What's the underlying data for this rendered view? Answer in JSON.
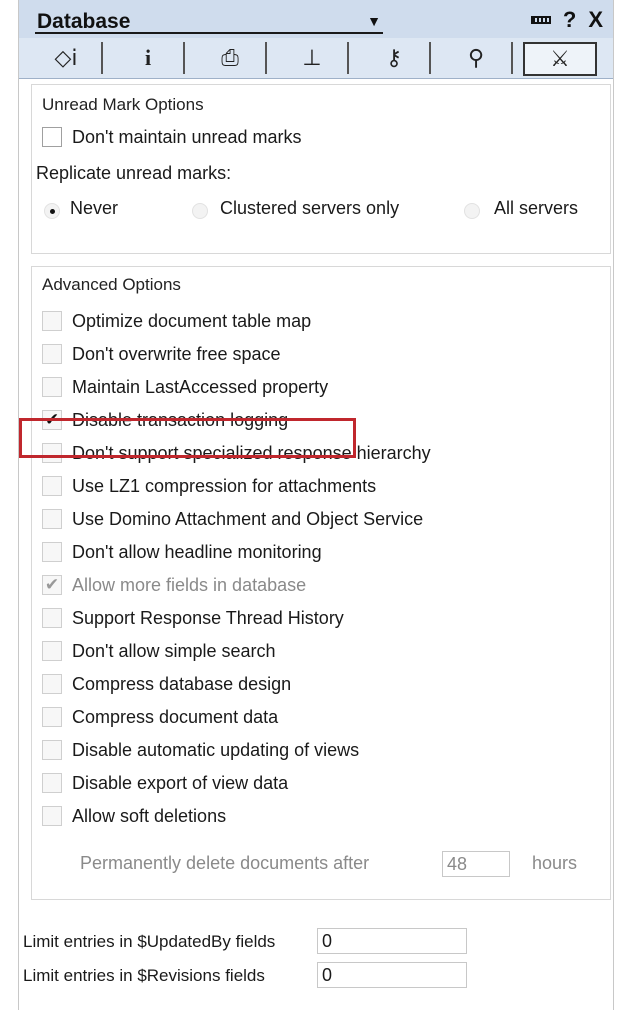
{
  "header": {
    "title": "Database",
    "question_glyph": "?",
    "close_glyph": "X"
  },
  "tabs": [
    {
      "icon": "info-pages-icon",
      "glyph": "◇ⅰ"
    },
    {
      "icon": "info-icon",
      "glyph": "i"
    },
    {
      "icon": "printer-icon",
      "glyph": "⎙"
    },
    {
      "icon": "design-icon",
      "glyph": "⊥"
    },
    {
      "icon": "key-icon",
      "glyph": "⚷"
    },
    {
      "icon": "search-icon",
      "glyph": "⚲"
    },
    {
      "icon": "advanced-icon",
      "glyph": "⚔",
      "active": true
    }
  ],
  "unread": {
    "title": "Unread Mark Options",
    "dont_maintain": "Don't maintain unread marks",
    "replicate_label": "Replicate unread marks:",
    "options": [
      "Never",
      "Clustered servers only",
      "All servers"
    ],
    "selected": "Never"
  },
  "advanced": {
    "title": "Advanced Options",
    "items": [
      {
        "label": "Optimize document table map",
        "checked": false,
        "disabled": false
      },
      {
        "label": "Don't overwrite free space",
        "checked": false,
        "disabled": false
      },
      {
        "label": "Maintain LastAccessed property",
        "checked": false,
        "disabled": false
      },
      {
        "label": "Disable transaction logging",
        "checked": true,
        "disabled": false
      },
      {
        "label": "Don't support specialized response hierarchy",
        "checked": false,
        "disabled": false
      },
      {
        "label": "Use LZ1 compression for attachments",
        "checked": false,
        "disabled": false
      },
      {
        "label": "Use Domino Attachment and Object Service",
        "checked": false,
        "disabled": false
      },
      {
        "label": "Don't allow headline monitoring",
        "checked": false,
        "disabled": false
      },
      {
        "label": "Allow more fields in database",
        "checked": true,
        "disabled": true
      },
      {
        "label": "Support Response Thread History",
        "checked": false,
        "disabled": false
      },
      {
        "label": "Don't allow simple search",
        "checked": false,
        "disabled": false
      },
      {
        "label": "Compress database design",
        "checked": false,
        "disabled": false
      },
      {
        "label": "Compress document data",
        "checked": false,
        "disabled": false
      },
      {
        "label": "Disable automatic updating of views",
        "checked": false,
        "disabled": false
      },
      {
        "label": "Disable export of view data",
        "checked": false,
        "disabled": false
      },
      {
        "label": "Allow soft deletions",
        "checked": false,
        "disabled": false
      }
    ],
    "soft_delete_prefix": "Permanently delete documents after",
    "soft_delete_value": "48",
    "soft_delete_suffix": "hours"
  },
  "limits": {
    "updatedby_label": "Limit entries in $UpdatedBy fields",
    "updatedby_value": "0",
    "revisions_label": "Limit entries in $Revisions fields",
    "revisions_value": "0"
  },
  "colors": {
    "highlight": "#c0272d",
    "titlebar": "#cfdced"
  }
}
